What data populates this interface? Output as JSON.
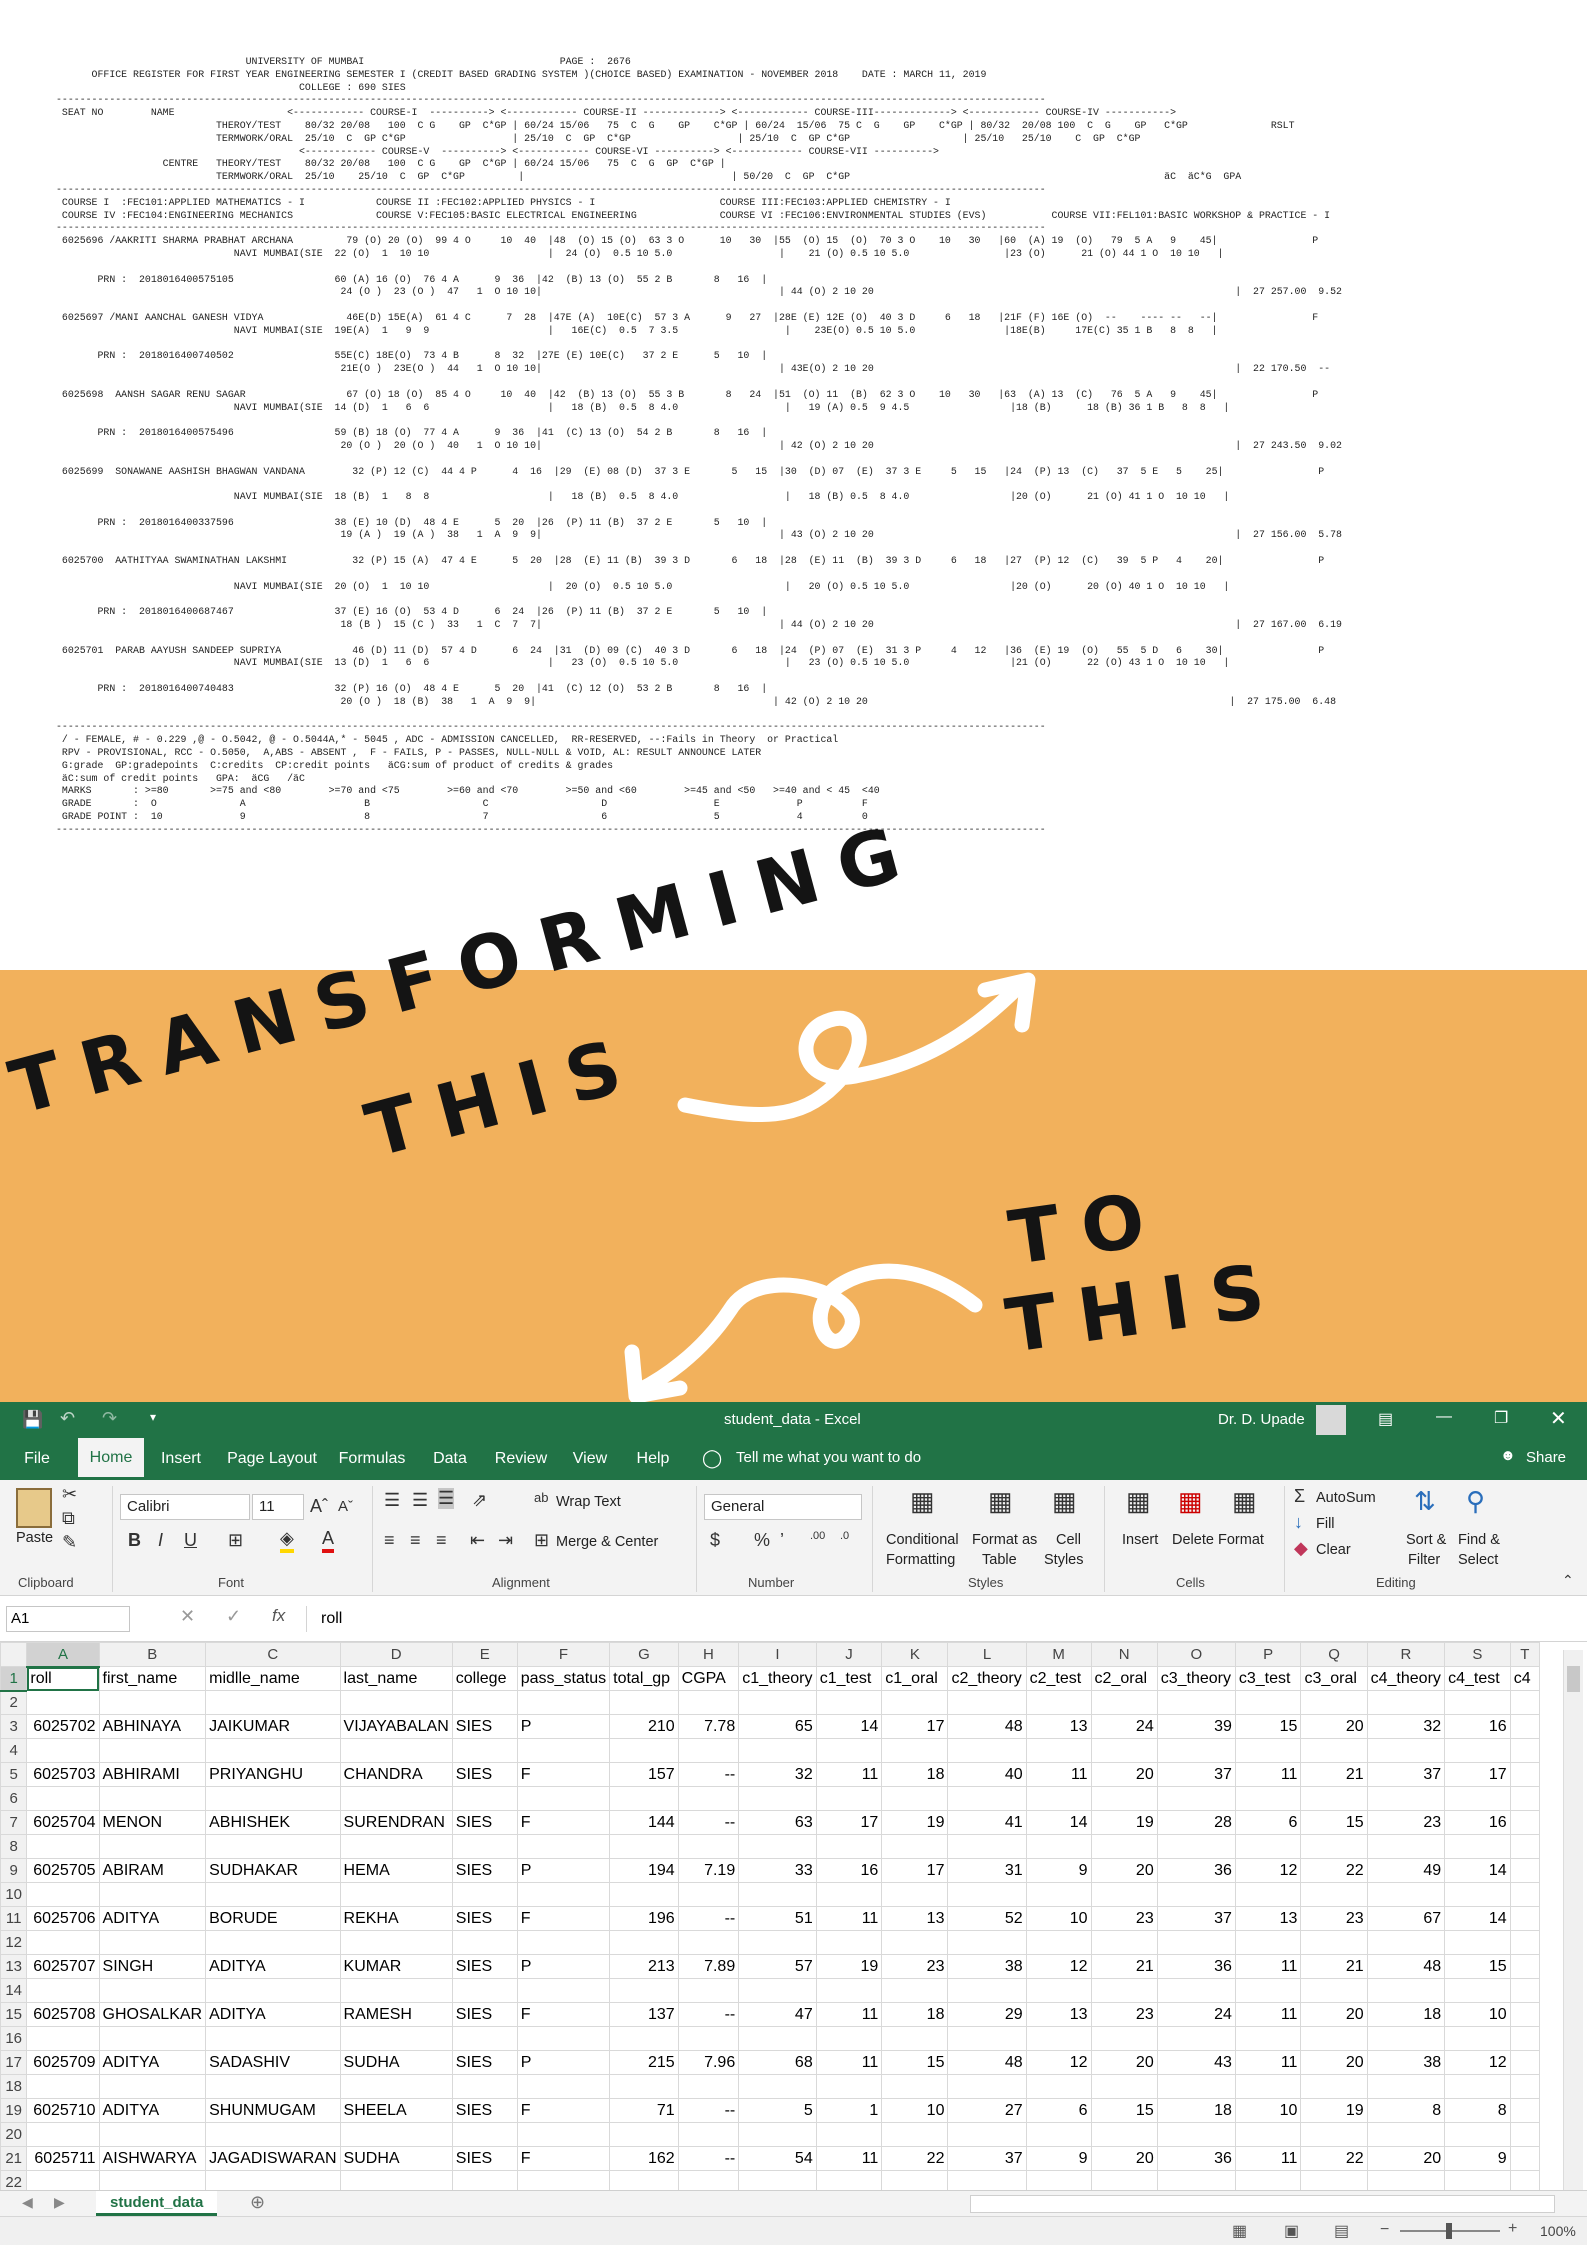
{
  "register": {
    "lines": [
      "                                UNIVERSITY OF MUMBAI                                 PAGE :  2676",
      "      OFFICE REGISTER FOR FIRST YEAR ENGINEERING SEMESTER I (CREDIT BASED GRADING SYSTEM )(CHOICE BASED) EXAMINATION - NOVEMBER 2018    DATE : MARCH 11, 2019",
      "                                         COLLEGE : 690 SIES",
      "-----------------------------------------------------------------------------------------------------------------------------------------------------------------------",
      " SEAT NO        NAME                   <------------ COURSE-I  ----------> <------------ COURSE-II -------------> <------------ COURSE-III-------------> <------------ COURSE-IV ----------->",
      "                           THEROY/TEST    80/32 20/08   100  C G    GP  C*GP | 60/24 15/06   75  C  G    GP    C*GP | 60/24  15/06  75 C  G    GP    C*GP | 80/32  20/08 100  C  G    GP   C*GP              RSLT",
      "                           TERMWORK/ORAL  25/10  C  GP C*GP                  | 25/10  C  GP  C*GP                  | 25/10  C  GP C*GP                   | 25/10   25/10    C  GP  C*GP",
      "                                         <------------ COURSE-V  ----------> <------------ COURSE-VI ----------> <------------ COURSE-VII ---------->",
      "                  CENTRE   THEORY/TEST    80/32 20/08   100  C G    GP  C*GP | 60/24 15/06   75  C  G  GP  C*GP |",
      "                           TERMWORK/ORAL  25/10    25/10  C  GP  C*GP         |                                   | 50/20  C  GP  C*GP                                                     äC  äC*G  GPA",
      "-----------------------------------------------------------------------------------------------------------------------------------------------------------------------",
      " COURSE I  :FEC101:APPLIED MATHEMATICS - I            COURSE II :FEC102:APPLIED PHYSICS - I                     COURSE III:FEC103:APPLIED CHEMISTRY - I",
      " COURSE IV :FEC104:ENGINEERING MECHANICS              COURSE V:FEC105:BASIC ELECTRICAL ENGINEERING              COURSE VI :FEC106:ENVIRONMENTAL STUDIES (EVS)           COURSE VII:FEL101:BASIC WORKSHOP & PRACTICE - I",
      "-----------------------------------------------------------------------------------------------------------------------------------------------------------------------",
      " 6025696 /AAKRITI SHARMA PRABHAT ARCHANA         79 (O) 20 (O)  99 4 O     10  40  |48  (O) 15 (O)  63 3 O      10   30  |55  (O) 15  (O)  70 3 O    10   30   |60  (A) 19  (O)   79  5 A   9    45|                P",
      "                              NAVI MUMBAI(SIE  22 (O)  1  10 10                    |  24 (O)  0.5 10 5.0                  |    21 (O) 0.5 10 5.0                |23 (O)      21 (O) 44 1 O  10 10   |",
      "",
      "       PRN :  2018016400575105                 60 (A) 16 (O)  76 4 A      9  36  |42  (B) 13 (O)  55 2 B       8   16  |",
      "                                                24 (O )  23 (O )  47   1  O 10 10|                                        | 44 (O) 2 10 20                                                             |  27 257.00  9.52",
      "",
      " 6025697 /MANI AANCHAL GANESH VIDYA              46E(D) 15E(A)  61 4 C      7  28  |47E (A)  10E(C)  57 3 A      9   27  |28E (E) 12E (O)  40 3 D     6   18   |21F (F) 16E (O)  --    ---- --   --|                F",
      "                              NAVI MUMBAI(SIE  19E(A)  1   9  9                    |   16E(C)  0.5  7 3.5                  |    23E(O) 0.5 10 5.0               |18E(B)     17E(C) 35 1 B   8  8   |",
      "",
      "       PRN :  2018016400740502                 55E(C) 18E(O)  73 4 B      8  32  |27E (E) 10E(C)   37 2 E      5   10  |",
      "                                                21E(O )  23E(O )  44   1  O 10 10|                                        | 43E(O) 2 10 20                                                             |  22 170.50  --",
      "",
      " 6025698  AANSH SAGAR RENU SAGAR                 67 (O) 18 (O)  85 4 O     10  40  |42  (B) 13 (O)  55 3 B       8   24  |51  (O) 11  (B)  62 3 O    10   30   |63  (A) 13  (C)   76  5 A   9    45|                P",
      "                              NAVI MUMBAI(SIE  14 (D)  1   6  6                    |   18 (B)  0.5  8 4.0                  |   19 (A) 0.5  9 4.5                 |18 (B)      18 (B) 36 1 B   8  8   |",
      "",
      "       PRN :  2018016400575496                 59 (B) 18 (O)  77 4 A      9  36  |41  (C) 13 (O)  54 2 B       8   16  |",
      "                                                20 (O )  20 (O )  40   1  O 10 10|                                        | 42 (O) 2 10 20                                                             |  27 243.50  9.02",
      "",
      " 6025699  SONAWANE AASHISH BHAGWAN VANDANA        32 (P) 12 (C)  44 4 P      4  16  |29  (E) 08 (D)  37 3 E       5   15  |30  (D) 07  (E)  37 3 E     5   15   |24  (P) 13  (C)   37  5 E   5    25|                P",
      "",
      "                              NAVI MUMBAI(SIE  18 (B)  1   8  8                    |   18 (B)  0.5  8 4.0                  |   18 (B) 0.5  8 4.0                 |20 (O)      21 (O) 41 1 O  10 10   |",
      "",
      "       PRN :  2018016400337596                 38 (E) 10 (D)  48 4 E      5  20  |26  (P) 11 (B)  37 2 E       5   10  |",
      "                                                19 (A )  19 (A )  38   1  A  9  9|                                        | 43 (O) 2 10 20                                                             |  27 156.00  5.78",
      "",
      " 6025700  AATHITYAA SWAMINATHAN LAKSHMI           32 (P) 15 (A)  47 4 E      5  20  |28  (E) 11 (B)  39 3 D       6   18  |28  (E) 11  (B)  39 3 D     6   18   |27  (P) 12  (C)   39  5 P   4    20|                P",
      "",
      "                              NAVI MUMBAI(SIE  20 (O)  1  10 10                    |  20 (O)  0.5 10 5.0                   |   20 (O) 0.5 10 5.0                 |20 (O)      20 (O) 40 1 O  10 10   |",
      "",
      "       PRN :  2018016400687467                 37 (E) 16 (O)  53 4 D      6  24  |26  (P) 11 (B)  37 2 E       5   10  |",
      "                                                18 (B )  15 (C )  33   1  C  7  7|                                        | 44 (O) 2 10 20                                                             |  27 167.00  6.19",
      "",
      " 6025701  PARAB AAYUSH SANDEEP SUPRIYA            46 (D) 11 (D)  57 4 D      6  24  |31  (D) 09 (C)  40 3 D       6   18  |24  (P) 07  (E)  31 3 P     4   12   |36  (E) 19  (O)   55  5 D   6    30|                P",
      "                              NAVI MUMBAI(SIE  13 (D)  1   6  6                    |   23 (O)  0.5 10 5.0                  |   23 (O) 0.5 10 5.0                 |21 (O)      22 (O) 43 1 O  10 10   |",
      "",
      "       PRN :  2018016400740483                 32 (P) 16 (O)  48 4 E      5  20  |41  (C) 12 (O)  53 2 B       8   16  |",
      "                                                20 (O )  18 (B)  38   1  A  9  9|                                        | 42 (O) 2 10 20                                                             |  27 175.00  6.48",
      "",
      "-----------------------------------------------------------------------------------------------------------------------------------------------------------------------",
      " / - FEMALE, # - 0.229 ,@ - O.5042, @ - O.5044A,* - 5045 , ADC - ADMISSION CANCELLED,  RR-RESERVED, --:Fails in Theory  or Practical",
      " RPV - PROVISIONAL, RCC - O.5050,  A,ABS - ABSENT ,  F - FAILS, P - PASSES, NULL-NULL & VOID, AL: RESULT ANNOUNCE LATER",
      " G:grade  GP:gradepoints  C:credits  CP:credit points   äCG:sum of product of credits & grades",
      " äC:sum of credit points   GPA:  äCG   /äC",
      " MARKS       : >=80       >=75 and <80        >=70 and <75        >=60 and <70        >=50 and <60        >=45 and <50   >=40 and < 45  <40",
      " GRADE       :  O              A                    B                   C                   D                  E             P          F",
      " GRADE POINT :  10             9                    8                   7                   6                  5             4          0",
      "-----------------------------------------------------------------------------------------------------------------------------------------------------------------------"
    ]
  },
  "banner": {
    "word1": "TRANSFORMING",
    "word2": "THIS",
    "word3": "TO",
    "word4": "THIS",
    "bg_color": "#f2b15c"
  },
  "excel": {
    "window_title": "student_data  -  Excel",
    "user_name": "Dr. D. Upade",
    "menu_tabs": [
      "File",
      "Home",
      "Insert",
      "Page Layout",
      "Formulas",
      "Data",
      "Review",
      "View",
      "Help"
    ],
    "active_tab": "Home",
    "tell_me": "Tell me what you want to do",
    "share": "Share",
    "ribbon": {
      "clipboard": {
        "label": "Clipboard",
        "paste": "Paste"
      },
      "font": {
        "label": "Font",
        "family": "Calibri",
        "size": "11",
        "bold": "B",
        "italic": "I",
        "underline": "U"
      },
      "alignment": {
        "label": "Alignment",
        "wrap_text": "Wrap Text",
        "merge_center": "Merge & Center"
      },
      "number": {
        "label": "Number",
        "format": "General"
      },
      "styles": {
        "label": "Styles",
        "conditional_1": "Conditional",
        "conditional_2": "Formatting",
        "format_table_1": "Format as",
        "format_table_2": "Table",
        "cell_styles_1": "Cell",
        "cell_styles_2": "Styles"
      },
      "cells": {
        "label": "Cells",
        "insert": "Insert",
        "delete": "Delete",
        "format": "Format"
      },
      "editing": {
        "label": "Editing",
        "autosum": "AutoSum",
        "fill": "Fill",
        "clear": "Clear",
        "sort_1": "Sort &",
        "sort_2": "Filter",
        "find_1": "Find &",
        "find_2": "Select"
      }
    },
    "name_box": "A1",
    "formula": "roll",
    "fx": "fx",
    "columns": [
      "A",
      "B",
      "C",
      "D",
      "E",
      "F",
      "G",
      "H",
      "I",
      "J",
      "K",
      "L",
      "M",
      "N",
      "O",
      "P",
      "Q",
      "R",
      "S",
      "T"
    ],
    "headers": [
      "roll",
      "first_name",
      "midlle_name",
      "last_name",
      "college",
      "pass_status",
      "total_gp",
      "CGPA",
      "c1_theory",
      "c1_test",
      "c1_oral",
      "c2_theory",
      "c2_test",
      "c2_oral",
      "c3_theory",
      "c3_test",
      "c3_oral",
      "c4_theory",
      "c4_test",
      "c4"
    ],
    "rows": [
      [
        "6025702",
        "ABHINAYA",
        "JAIKUMAR",
        "VIJAYABALAN",
        "SIES",
        "P",
        "210",
        "7.78",
        "65",
        "14",
        "17",
        "48",
        "13",
        "24",
        "39",
        "15",
        "20",
        "32",
        "16",
        ""
      ],
      [
        "6025703",
        "ABHIRAMI",
        "PRIYANGHU",
        "CHANDRA",
        "SIES",
        "F",
        "157",
        "--",
        "32",
        "11",
        "18",
        "40",
        "11",
        "20",
        "37",
        "11",
        "21",
        "37",
        "17",
        ""
      ],
      [
        "6025704",
        "MENON",
        "ABHISHEK",
        "SURENDRAN",
        "SIES",
        "F",
        "144",
        "--",
        "63",
        "17",
        "19",
        "41",
        "14",
        "19",
        "28",
        "6",
        "15",
        "23",
        "16",
        ""
      ],
      [
        "6025705",
        "ABIRAM",
        "SUDHAKAR",
        "HEMA",
        "SIES",
        "P",
        "194",
        "7.19",
        "33",
        "16",
        "17",
        "31",
        "9",
        "20",
        "36",
        "12",
        "22",
        "49",
        "14",
        ""
      ],
      [
        "6025706",
        "ADITYA",
        "BORUDE",
        "REKHA",
        "SIES",
        "F",
        "196",
        "--",
        "51",
        "11",
        "13",
        "52",
        "10",
        "23",
        "37",
        "13",
        "23",
        "67",
        "14",
        ""
      ],
      [
        "6025707",
        "SINGH",
        "ADITYA",
        "KUMAR",
        "SIES",
        "P",
        "213",
        "7.89",
        "57",
        "19",
        "23",
        "38",
        "12",
        "21",
        "36",
        "11",
        "21",
        "48",
        "15",
        ""
      ],
      [
        "6025708",
        "GHOSALKAR",
        "ADITYA",
        "RAMESH",
        "SIES",
        "F",
        "137",
        "--",
        "47",
        "11",
        "18",
        "29",
        "13",
        "23",
        "24",
        "11",
        "20",
        "18",
        "10",
        ""
      ],
      [
        "6025709",
        "ADITYA",
        "SADASHIV",
        "SUDHA",
        "SIES",
        "P",
        "215",
        "7.96",
        "68",
        "11",
        "15",
        "48",
        "12",
        "20",
        "43",
        "11",
        "20",
        "38",
        "12",
        ""
      ],
      [
        "6025710",
        "ADITYA",
        "SHUNMUGAM",
        "SHEELA",
        "SIES",
        "F",
        "71",
        "--",
        "5",
        "1",
        "10",
        "27",
        "6",
        "15",
        "18",
        "10",
        "19",
        "8",
        "8",
        ""
      ],
      [
        "6025711",
        "AISHWARYA",
        "JAGADISWARAN",
        "SUDHA",
        "SIES",
        "F",
        "162",
        "--",
        "54",
        "11",
        "22",
        "37",
        "9",
        "20",
        "36",
        "11",
        "22",
        "20",
        "9",
        ""
      ]
    ],
    "sheet_tab": "student_data",
    "zoom": "100%"
  }
}
